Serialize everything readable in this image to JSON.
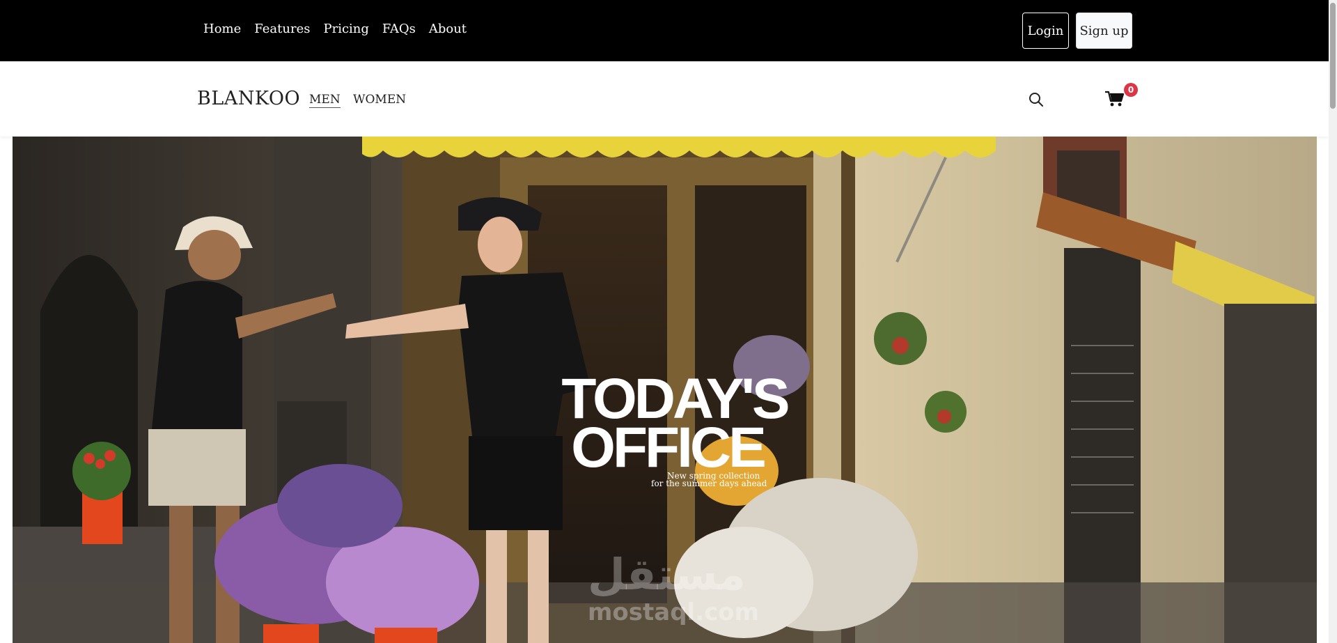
{
  "topnav": {
    "links": [
      "Home",
      "Features",
      "Pricing",
      "FAQs",
      "About"
    ],
    "login_label": "Login",
    "signup_label": "Sign up"
  },
  "shop": {
    "brand": "BLANKOO",
    "categories": [
      "MEN",
      "WOMEN"
    ],
    "active_category": "MEN",
    "cart_count": "0",
    "icons": [
      "search-icon",
      "cart-icon"
    ]
  },
  "hero": {
    "title_line1": "TODAY'S",
    "title_line2": "OFFICE",
    "subtitle_line1": "New  spring collection",
    "subtitle_line2": "for the summer days ahead",
    "watermark_arabic": "مستقل",
    "watermark_text": "mostaql.com"
  },
  "colors": {
    "topbar_bg": "#000000",
    "badge": "#dc3545",
    "awning": "#e8d43a"
  }
}
